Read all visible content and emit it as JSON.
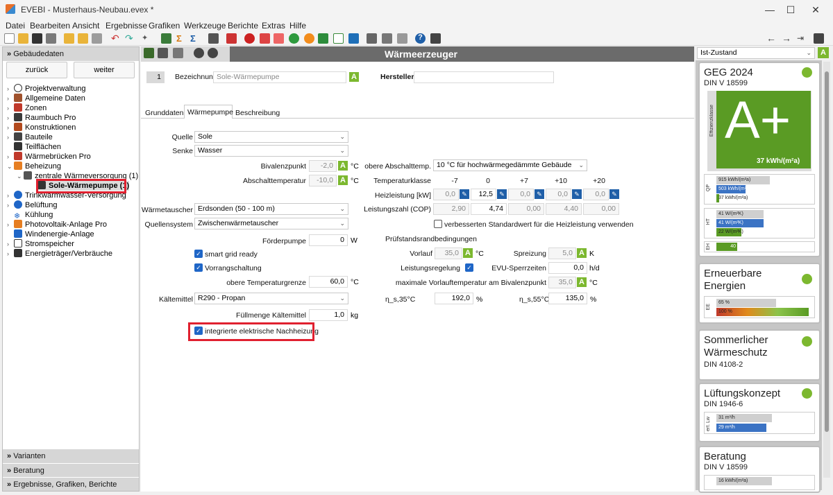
{
  "window": {
    "app": "EVEBI",
    "title": "EVEBI  - Musterhaus-Neubau.evex *"
  },
  "menu": [
    "Datei",
    "Bearbeiten",
    "Ansicht",
    "Ergebnisse",
    "Grafiken",
    "Werkzeuge",
    "Berichte",
    "Extras",
    "Hilfe"
  ],
  "left": {
    "header": "Gebäudedaten",
    "back": "zurück",
    "next": "weiter",
    "tree": [
      {
        "label": "Projektverwaltung"
      },
      {
        "label": "Allgemeine Daten"
      },
      {
        "label": "Zonen"
      },
      {
        "label": "Raumbuch Pro"
      },
      {
        "label": "Konstruktionen"
      },
      {
        "label": "Bauteile"
      },
      {
        "label": "Teilflächen"
      },
      {
        "label": "Wärmebrücken Pro"
      },
      {
        "label": "Beheizung"
      },
      {
        "label": "zentrale Wärmeversorgung (1)"
      },
      {
        "label": "Sole-Wärmepumpe (1)"
      },
      {
        "label": "Trinkwarmwasser-Versorgung"
      },
      {
        "label": "Belüftung"
      },
      {
        "label": "Kühlung"
      },
      {
        "label": "Photovoltaik-Anlage Pro"
      },
      {
        "label": "Windenergie-Anlage"
      },
      {
        "label": "Stromspeicher"
      },
      {
        "label": "Energieträger/Verbräuche"
      }
    ],
    "bottom": [
      "Varianten",
      "Beratung",
      "Ergebnisse, Grafiken, Berichte"
    ]
  },
  "main": {
    "title": "Wärmeerzeuger",
    "number": "1",
    "bezeichnung_label": "Bezeichnung",
    "bezeichnung_value": "Sole-Wärmepumpe",
    "hersteller_label": "Hersteller",
    "hersteller_value": "",
    "tabs": [
      "Grunddaten",
      "Wärmepumpe",
      "Beschreibung"
    ],
    "quelle_label": "Quelle",
    "quelle": "Sole",
    "senke_label": "Senke",
    "senke": "Wasser",
    "bivalenz_label": "Bivalenzpunkt",
    "bivalenz": "-2,0",
    "abschalt_label": "Abschalttemperatur",
    "abschalt": "-10,0",
    "waermetauscher_label": "Wärmetauscher",
    "waermetauscher": "Erdsonden (50 - 100 m)",
    "quellsystem_label": "Quellensystem",
    "quellsystem": "Zwischenwärmetauscher",
    "foerderpumpe_label": "Förderpumpe",
    "foerderpumpe": "0",
    "smartgrid": "smart grid ready",
    "vorrang": "Vorrangschaltung",
    "obere_grenze_label": "obere Temperaturgrenze",
    "obere_grenze": "60,0",
    "kaeltemittel_label": "Kältemittel",
    "kaeltemittel": "R290 - Propan",
    "fuellmenge_label": "Füllmenge Kältemittel",
    "fuellmenge": "1,0",
    "nachheizung": "integrierte elektrische Nachheizung",
    "obere_abschalt_label": "obere Abschalttemp.",
    "obere_abschalt": "10 °C für hochwärmegedämmte Gebäude",
    "tk_label": "Temperaturklasse",
    "tk": [
      "-7",
      "0",
      "+7",
      "+10",
      "+20"
    ],
    "heizleistung_label": "Heizleistung [kW]",
    "heizleistung": [
      "0,0",
      "12,5",
      "0,0",
      "0,0",
      "0,0"
    ],
    "cop_label": "Leistungszahl (COP)",
    "cop": [
      "2,90",
      "4,74",
      "0,00",
      "4,40",
      "0,00"
    ],
    "verbesserten": "verbesserten Standardwert für die Heizleistung verwenden",
    "pruef_label": "Prüfstandsrandbedingungen",
    "vorlauf_label": "Vorlauf",
    "vorlauf": "35,0",
    "spreizung_label": "Spreizung",
    "spreizung": "5,0",
    "leistungsreg_label": "Leistungsregelung",
    "evu_label": "EVU-Sperrzeiten",
    "evu": "0,0",
    "maxvl_label": "maximale Vorlauftemperatur am Bivalenzpunkt",
    "maxvl": "35,0",
    "eta35_label": "η_s,35°C",
    "eta35": "192,0",
    "eta55_label": "η_s,55°C",
    "eta55": "135,0",
    "units": {
      "c": "°C",
      "w": "W",
      "k": "K",
      "hd": "h/d",
      "pct": "%",
      "kg": "kg"
    },
    "a": "A"
  },
  "right": {
    "zustand": "Ist-Zustand",
    "geg_title": "GEG 2024",
    "geg_sub": "DIN V 18599",
    "effizienz_label": "Effizienzklasse",
    "grade": "A+",
    "grade_value": "37 kWh/(m²a)",
    "qp": [
      "915 kWh/(m²a)",
      "503 kWh/(m²a)",
      "37 kWh/(m²a)"
    ],
    "ht": [
      "41 W/(m²K)",
      "41 W/(m²K)",
      "22 W/(m²K)"
    ],
    "eh": "40",
    "qp_label": "QP",
    "ht_label": "HT",
    "eh_label": "EH",
    "ee_title": "Erneuerbare Energien",
    "ee_label": "EE",
    "ee": [
      "65 %",
      "100 %"
    ],
    "sw_title": "Sommerlicher Wärmeschutz",
    "sw_sub": "DIN 4108-2",
    "lk_title": "Lüftungskonzept",
    "lk_sub": "DIN 1946-6",
    "lk_label": "erf. Lw",
    "lk": [
      "31 m³/h",
      "29 m³/h"
    ],
    "ber_title": "Beratung",
    "ber_sub": "DIN V 18599",
    "ber": "16 kWh/(m²a)"
  }
}
